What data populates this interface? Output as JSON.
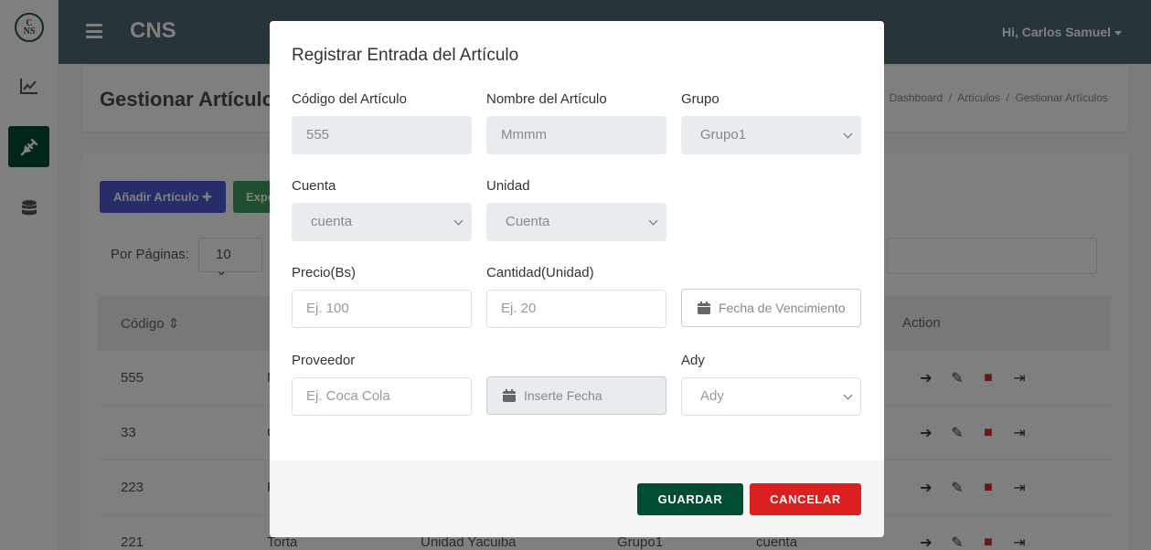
{
  "app": {
    "brand": "CNS",
    "user_greeting": "Hi, Carlos Samuel",
    "logo_text_top": "C",
    "logo_text_bottom": "NS"
  },
  "page": {
    "title": "Gestionar Artículos",
    "breadcrumb": [
      "Dashboard",
      "Artículos",
      "Gestionar Artículos"
    ],
    "add_button": "Añadir Artículo",
    "export_button": "Expo",
    "per_page_label": "Por Páginas:",
    "per_page_value": "10",
    "table_headers": [
      "Código",
      "Action"
    ],
    "rows": [
      {
        "code": "555",
        "initial": "M"
      },
      {
        "code": "33",
        "initial": "C"
      },
      {
        "code": "223",
        "initial": "F"
      },
      {
        "code": "221",
        "name": "Torta",
        "unit": "Unidad Yacuiba",
        "group": "Grupo1",
        "account": "cuenta"
      }
    ]
  },
  "modal": {
    "title": "Registrar Entrada del Artículo",
    "fields": {
      "codigo": {
        "label": "Código del Artículo",
        "value": "555"
      },
      "nombre": {
        "label": "Nombre del Artículo",
        "value": "Mmmm"
      },
      "grupo": {
        "label": "Grupo",
        "value": "Grupo1"
      },
      "cuenta": {
        "label": "Cuenta",
        "value": "cuenta"
      },
      "unidad": {
        "label": "Unidad",
        "value": "Cuenta"
      },
      "precio": {
        "label": "Precio(Bs)",
        "placeholder": "Ej. 100"
      },
      "cantidad": {
        "label": "Cantidad(Unidad)",
        "placeholder": "Ej. 20"
      },
      "vencimiento": {
        "placeholder": "Fecha de Vencimiento"
      },
      "proveedor": {
        "label": "Proveedor",
        "placeholder": "Ej. Coca Cola"
      },
      "fecha": {
        "placeholder": "Inserte Fecha"
      },
      "ady": {
        "label": "Ady",
        "value": "Ady"
      }
    },
    "save_label": "GUARDAR",
    "cancel_label": "CANCELAR"
  },
  "colors": {
    "topbar": "#4e6873",
    "primary_green": "#004d33",
    "danger": "#dc1f1f"
  }
}
